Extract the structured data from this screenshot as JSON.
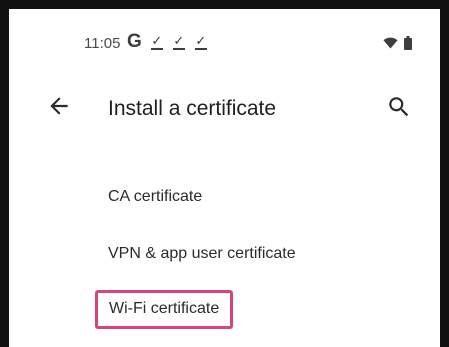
{
  "status_bar": {
    "time": "11:05",
    "google_icon": "G",
    "download_icons": [
      "download-done-icon",
      "download-done-icon",
      "download-done-icon"
    ],
    "system_icons": [
      "wifi-icon",
      "battery-icon"
    ]
  },
  "app_bar": {
    "back_icon": "arrow-left-icon",
    "title": "Install a certificate",
    "search_icon": "search-icon"
  },
  "list": {
    "items": [
      {
        "label": "CA certificate",
        "highlighted": false
      },
      {
        "label": "VPN & app user certificate",
        "highlighted": false
      },
      {
        "label": "Wi-Fi certificate",
        "highlighted": true
      }
    ]
  },
  "colors": {
    "highlight_border": "#d6447e",
    "frame": "#111111",
    "text": "#2b2b2b"
  }
}
